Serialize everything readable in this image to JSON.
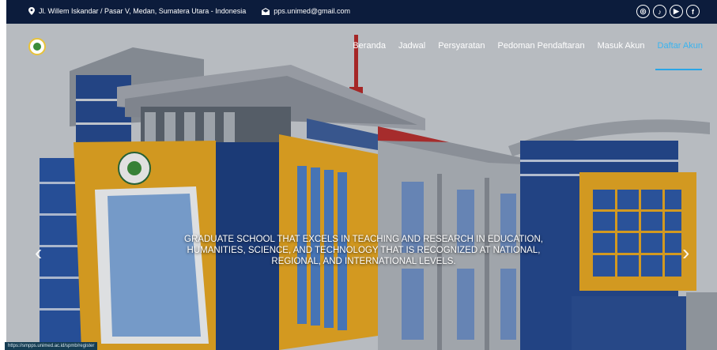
{
  "topbar": {
    "address": "Jl. Willem Iskandar / Pasar V, Medan, Sumatera Utara - Indonesia",
    "email": "pps.unimed@gmail.com",
    "socials": [
      "instagram-icon",
      "tiktok-icon",
      "youtube-icon",
      "facebook-icon"
    ]
  },
  "nav": {
    "items": [
      "Beranda",
      "Jadwal",
      "Persyaratan",
      "Pedoman Pendaftaran",
      "Masuk Akun",
      "Daftar Akun"
    ],
    "active": "Daftar Akun"
  },
  "hero": {
    "caption_lines": [
      "GRADUATE SCHOOL THAT EXCELS IN TEACHING AND RESEARCH IN EDUCATION,",
      "HUMANITIES, SCIENCE, AND TECHNOLOGY THAT IS RECOGNIZED AT NATIONAL,",
      "REGIONAL, AND INTERNATIONAL LEVELS."
    ],
    "prev_icon": "chevron-left-icon",
    "next_icon": "chevron-right-icon"
  },
  "status_url": "https://smpps.unimed.ac.id/spmb/register",
  "colors": {
    "topbar": "#0c1c3c",
    "accent": "#2aa5e6",
    "building_yellow": "#e3a523",
    "building_blue": "#25498f"
  }
}
